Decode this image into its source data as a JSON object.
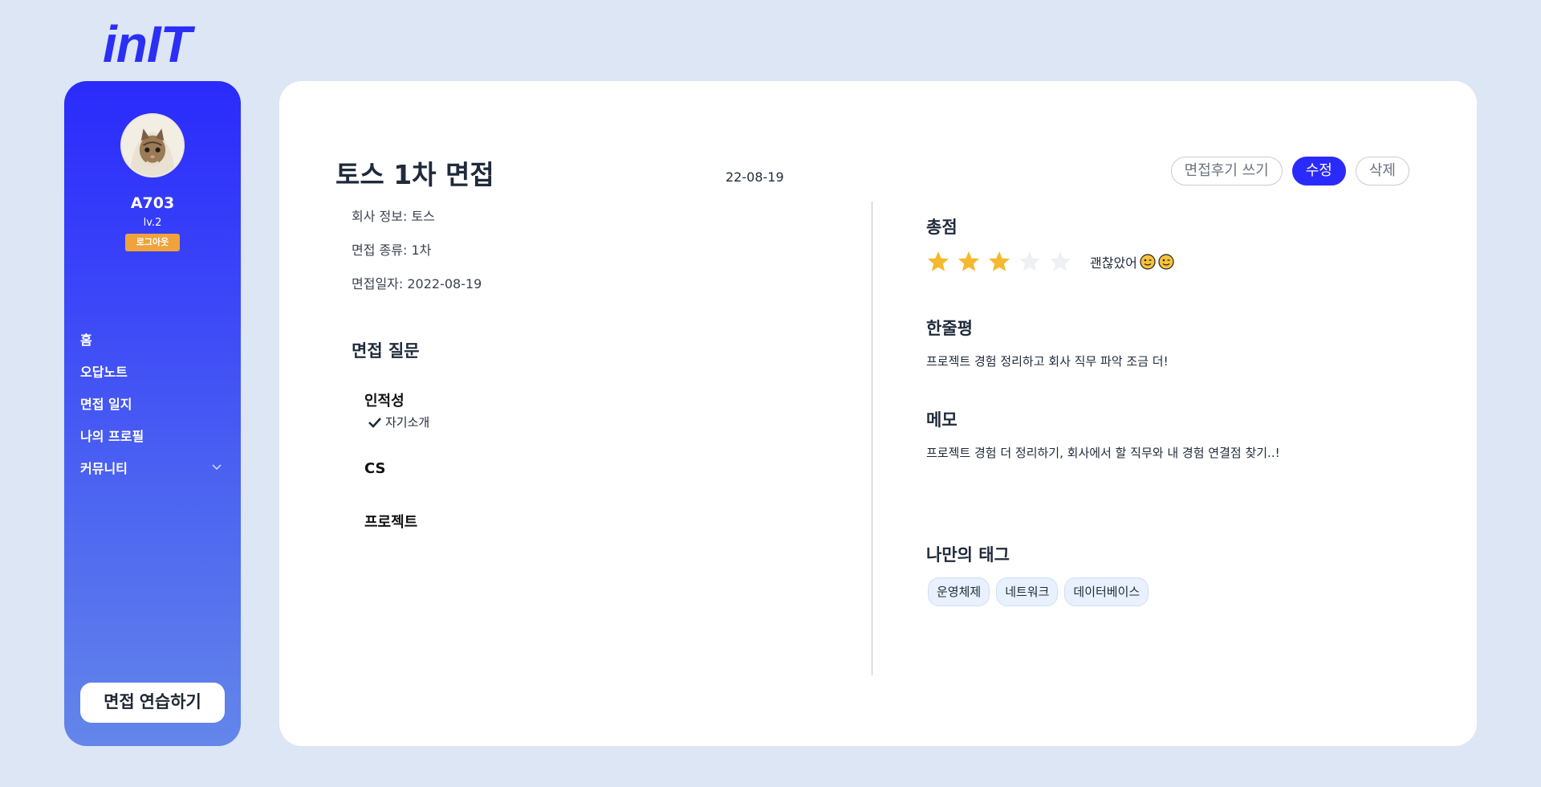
{
  "brand": {
    "logo": "inIT"
  },
  "sidebar": {
    "user_name": "A703",
    "user_level": "lv.2",
    "logout_label": "로그아웃",
    "nav": [
      {
        "label": "홈"
      },
      {
        "label": "오답노트"
      },
      {
        "label": "면접 일지"
      },
      {
        "label": "나의 프로필"
      },
      {
        "label": "커뮤니티",
        "has_dropdown": true
      }
    ],
    "practice_button": "면접 연습하기"
  },
  "interview": {
    "title": "토스 1차 면접",
    "date": "22-08-19",
    "actions": {
      "review": "면접후기 쓰기",
      "edit": "수정",
      "delete": "삭제"
    },
    "company": "회사 정보: 토스",
    "type": "면접 종류: 1차",
    "interview_date": "면접일자: 2022-08-19",
    "questions_title": "면접 질문",
    "categories": [
      {
        "name": "인적성",
        "items": [
          "자기소개"
        ]
      },
      {
        "name": "CS",
        "items": []
      },
      {
        "name": "프로젝트",
        "items": []
      }
    ]
  },
  "review": {
    "score_title": "총점",
    "rating": 3,
    "rating_max": 5,
    "rating_text": "괜찮았어",
    "one_liner_title": "한줄평",
    "one_liner": "프로젝트 경험 정리하고 회사 직무 파악 조금 더!",
    "memo_title": "메모",
    "memo": "프로젝트 경험 더 정리하기, 회사에서 할 직무와 내 경험 연결점 찾기..!",
    "tags_title": "나만의 태그",
    "tags": [
      "운영체제",
      "네트워크",
      "데이터베이스"
    ]
  },
  "colors": {
    "accent": "#2a2bfb",
    "star_on": "#f5b82e",
    "star_off": "#eef0f4",
    "logout_badge": "#f0a33a"
  },
  "icons": {
    "check": "check-icon",
    "chevron": "chevron-down-icon",
    "star": "star-icon",
    "emoji": "wink-emoji-icon"
  }
}
